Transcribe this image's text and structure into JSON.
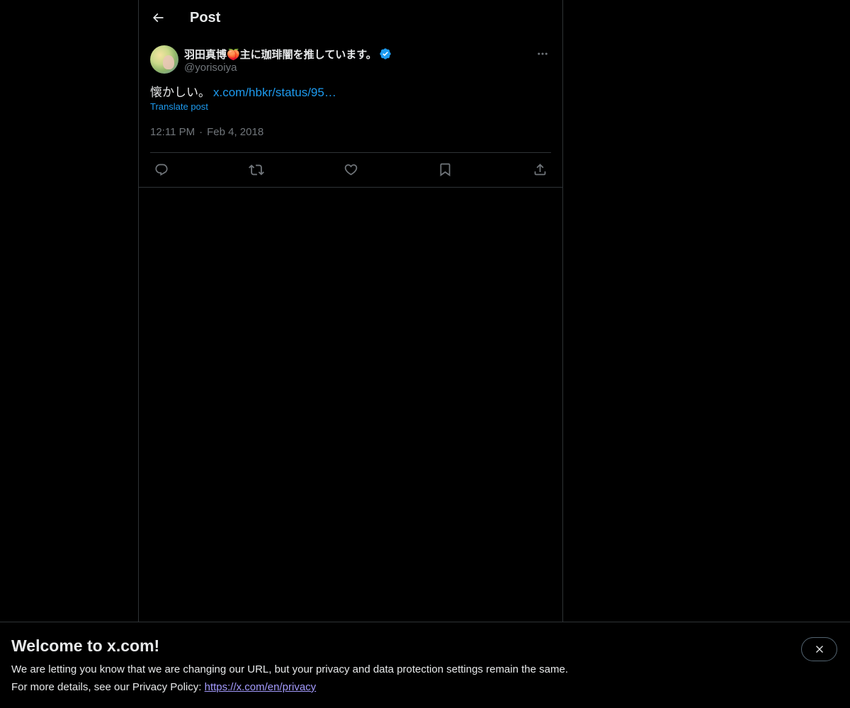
{
  "header": {
    "title": "Post"
  },
  "post": {
    "author": {
      "display_name": "羽田真博🍑主に珈琲闇を推しています。",
      "handle": "@yorisoiya",
      "verified": true
    },
    "text": "懐かしい。",
    "link_text": "x.com/hbkr/status/95…",
    "translate_label": "Translate post",
    "time": "12:11 PM",
    "separator": "·",
    "date": "Feb 4, 2018"
  },
  "banner": {
    "title": "Welcome to x.com!",
    "line1": "We are letting you know that we are changing our URL, but your privacy and data protection settings remain the same.",
    "line2_prefix": "For more details, see our Privacy Policy:",
    "privacy_link": "https://x.com/en/privacy"
  },
  "icons": {
    "back": "arrow-left-icon",
    "more": "more-horizontal-icon",
    "reply": "reply-icon",
    "repost": "repost-icon",
    "like": "heart-icon",
    "bookmark": "bookmark-icon",
    "share": "share-icon",
    "close": "close-icon",
    "verified": "verified-badge-icon"
  },
  "colors": {
    "background": "#000000",
    "text": "#e7e9ea",
    "muted": "#71767b",
    "accent": "#1d9bf0",
    "border": "#2f3336",
    "privacy_link": "#a49bff"
  }
}
